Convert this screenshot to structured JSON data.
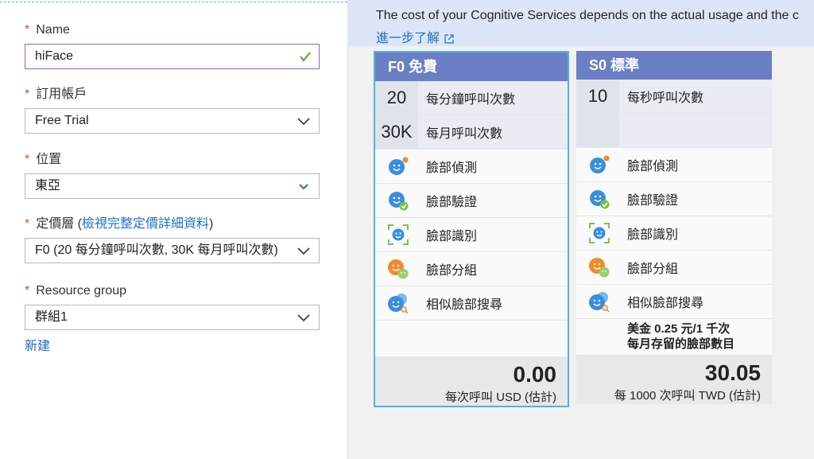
{
  "form": {
    "name": {
      "label": "Name",
      "value": "hiFace"
    },
    "subscription": {
      "label": "訂用帳戶",
      "value": "Free Trial"
    },
    "location": {
      "label": "位置",
      "value": "東亞"
    },
    "pricing": {
      "label_prefix": "定價層 (",
      "link": "檢視完整定價詳細資料",
      "label_suffix": ")",
      "value": "F0 (20 每分鐘呼叫次數, 30K 每月呼叫次數)"
    },
    "resource_group": {
      "label": "Resource group",
      "value": "群組1",
      "new_link": "新建"
    },
    "required_mark": "*"
  },
  "banner": {
    "text": "The cost of your Cognitive Services depends on the actual usage and the c",
    "more": "進一步了解"
  },
  "tiers": [
    {
      "name": "F0  免費",
      "quota": [
        {
          "num": "20",
          "label": "每分鐘呼叫次數"
        },
        {
          "num": "30K",
          "label": "每月呼叫次數"
        }
      ],
      "features": [
        "臉部偵測",
        "臉部驗證",
        "臉部識別",
        "臉部分組",
        "相似臉部搜尋"
      ],
      "note_line1": "",
      "note_line2": "",
      "price": "0.00",
      "unit": "每次呼叫 USD (估計)"
    },
    {
      "name": "S0  標準",
      "quota": [
        {
          "num": "10",
          "label": "每秒呼叫次數"
        },
        {
          "num": "",
          "label": ""
        }
      ],
      "features": [
        "臉部偵測",
        "臉部驗證",
        "臉部識別",
        "臉部分組",
        "相似臉部搜尋"
      ],
      "note_line1": "美金 0.25 元/1 千次",
      "note_line2": "每月存留的臉部數目",
      "price": "30.05",
      "unit": "每 1000 次呼叫 TWD (估計)"
    }
  ],
  "icons": [
    "face-detect-icon",
    "face-verify-icon",
    "face-identify-icon",
    "face-group-icon",
    "similar-face-icon"
  ],
  "colors": {
    "tier_header": "#6b7fc6",
    "selected_border": "#4fb3e3",
    "link": "#1f6fc1",
    "required": "#e0443d",
    "valid": "#5aa02c"
  }
}
